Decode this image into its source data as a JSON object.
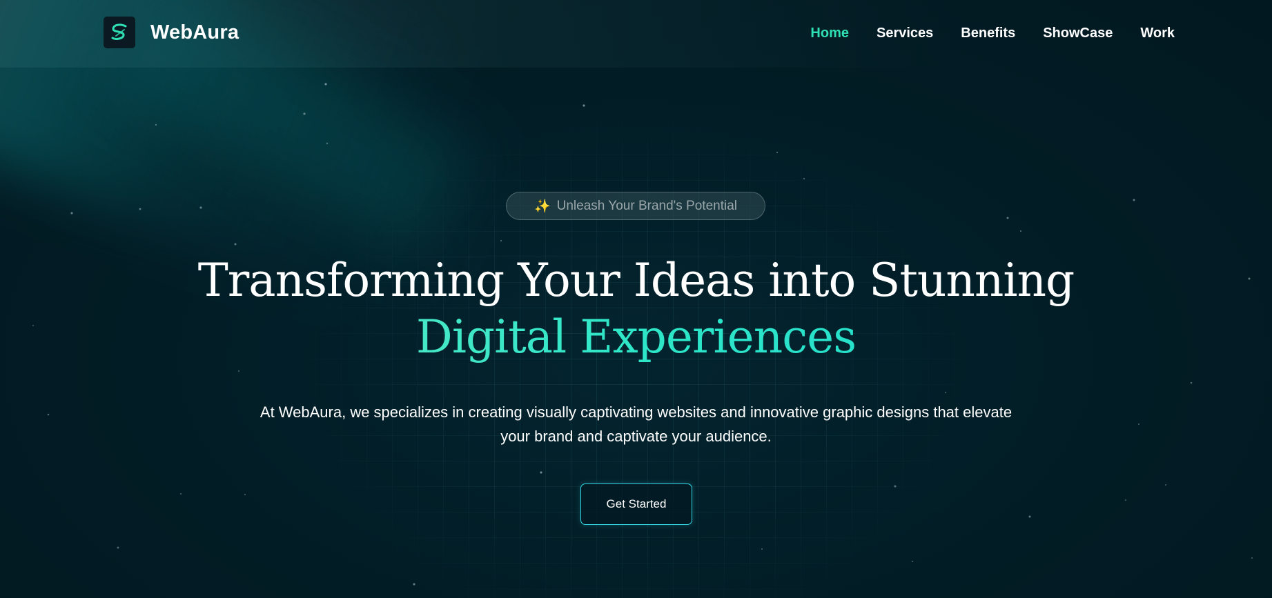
{
  "brand": {
    "name": "WebAura",
    "logo_icon": "swirl-s-icon",
    "accent_color": "#2fe0b4"
  },
  "nav": {
    "items": [
      {
        "label": "Home",
        "active": true
      },
      {
        "label": "Services",
        "active": false
      },
      {
        "label": "Benefits",
        "active": false
      },
      {
        "label": "ShowCase",
        "active": false
      },
      {
        "label": "Work",
        "active": false
      }
    ]
  },
  "hero": {
    "badge_icon": "sparkles-icon",
    "badge": "Unleash Your Brand's Potential",
    "title_line1": "Transforming Your Ideas into Stunning",
    "title_line2_word1": "Digital",
    "title_line2_word2": "Experiences",
    "subtitle_line1": "At WebAura, we specializes in creating visually captivating websites and innovative graphic designs that elevate",
    "subtitle_line2": "your brand and captivate your audience.",
    "cta_label": "Get Started"
  }
}
